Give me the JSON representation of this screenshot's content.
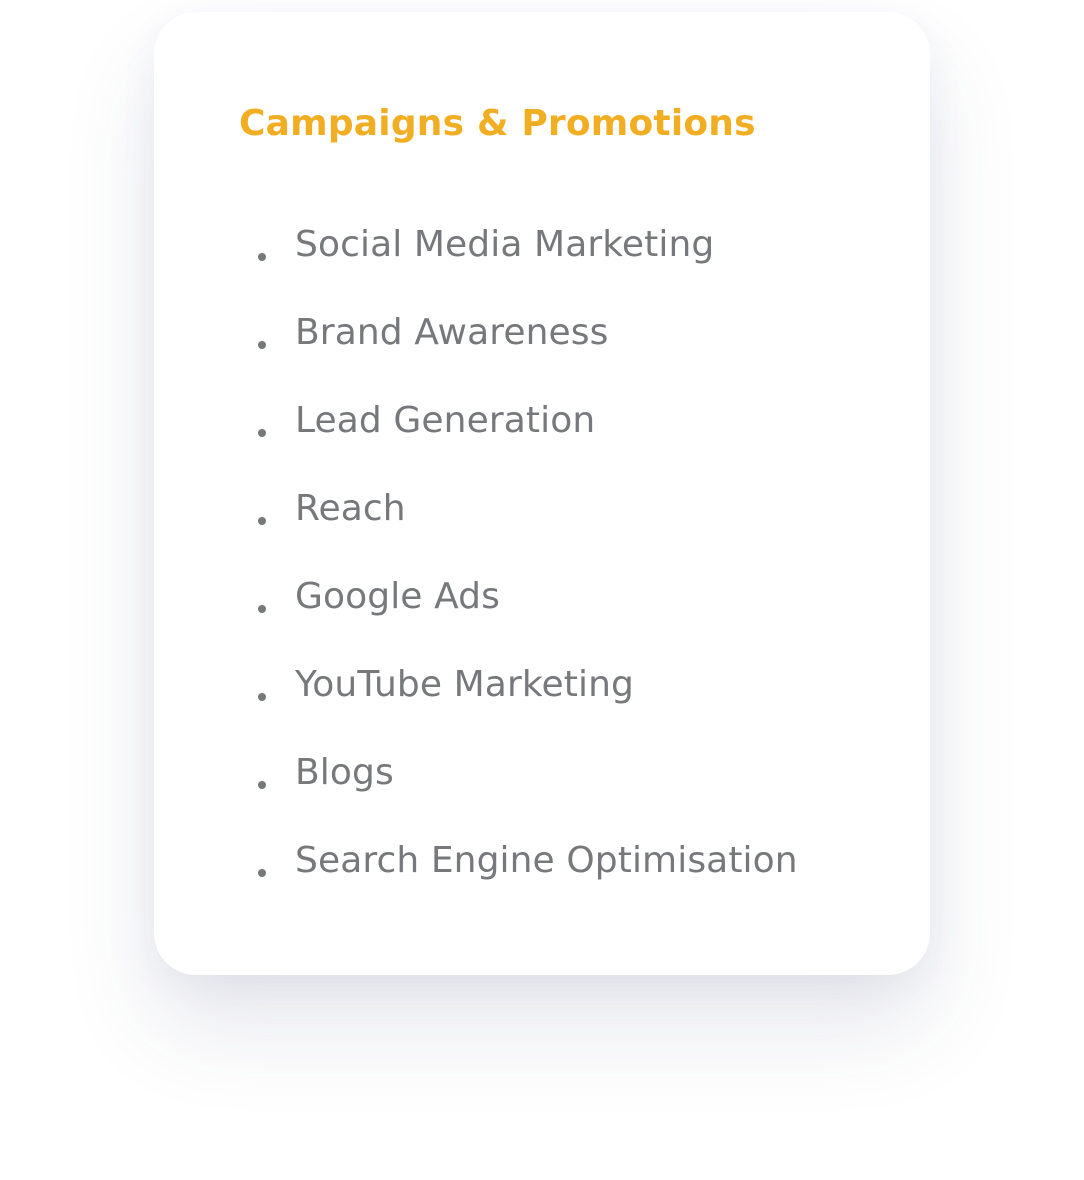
{
  "colors": {
    "accent": "#F2AE23",
    "text": "#76787B",
    "bullet": "#76787B",
    "card_background": "#FFFFFF",
    "page_background": "#FFFFFF"
  },
  "card": {
    "title": "Campaigns & Promotions",
    "items": [
      {
        "label": "Social Media Marketing"
      },
      {
        "label": "Brand Awareness"
      },
      {
        "label": "Lead Generation"
      },
      {
        "label": "Reach"
      },
      {
        "label": "Google Ads"
      },
      {
        "label": "YouTube Marketing"
      },
      {
        "label": "Blogs"
      },
      {
        "label": "Search Engine Optimisation"
      }
    ]
  }
}
